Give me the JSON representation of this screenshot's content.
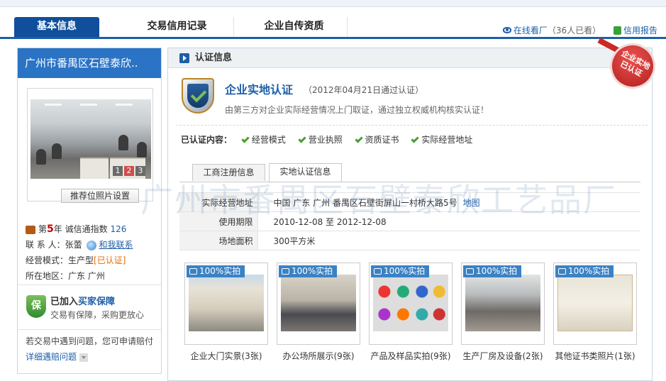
{
  "tabs": [
    {
      "label": "基本信息"
    },
    {
      "label": "交易信用记录"
    },
    {
      "label": "企业自传资质"
    }
  ],
  "toplinks": {
    "online_factory": "在线看厂",
    "viewers": "（36人已看）",
    "credit_report": "信用报告"
  },
  "sidebar": {
    "company": "广州市番禺区石壁泰欣..",
    "pager": [
      "1",
      "2",
      "3"
    ],
    "recommend_btn": "推荐位照片设置",
    "year_prefix": "第",
    "years": "5",
    "year_suffix": "年",
    "index_label": "诚信通指数",
    "index_value": "126",
    "contact_label": "联 系 人：张蕾",
    "chat_link": "和我联系",
    "mode_label": "经营模式：生产型",
    "mode_verified": "[已认证]",
    "region_label": "所在地区：广东 广州",
    "guard_prefix": "已加入",
    "guard_name": "买家保障",
    "guard_desc": "交易有保障，采购更放心",
    "claim_text": "若交易中遇到问题，您可申请赔付",
    "claim_link": "详细遇赔问题"
  },
  "cert": {
    "header": "认证信息",
    "seal_line1": "企业实地",
    "seal_line2": "已认证",
    "title": "企业实地认证",
    "date": "（2012年04月21日通过认证）",
    "desc": "由第三方对企业实际经营情况上门取证，通过独立权威机构核实认证！",
    "items_label": "已认证内容：",
    "items": [
      "经营模式",
      "营业执照",
      "资质证书",
      "实际经营地址"
    ],
    "subtabs": [
      "工商注册信息",
      "实地认证信息"
    ],
    "rows": [
      {
        "k": "实际经营地址",
        "v": "中国 广东 广州 番禺区石壁街屏山一村桥大路5号",
        "link": "地图"
      },
      {
        "k": "使用期限",
        "v": "2010-12-08 至 2012-12-08"
      },
      {
        "k": "场地面积",
        "v": "300平方米"
      }
    ],
    "watermark": "广州市番禺区石壁泰欣工艺品厂"
  },
  "photos": {
    "badge": "100%实拍",
    "captions": [
      "企业大门实景(3张)",
      "办公场所展示(9张)",
      "产品及样品实拍(9张)",
      "生产厂房及设备(2张)",
      "其他证书类照片(1张)"
    ]
  }
}
